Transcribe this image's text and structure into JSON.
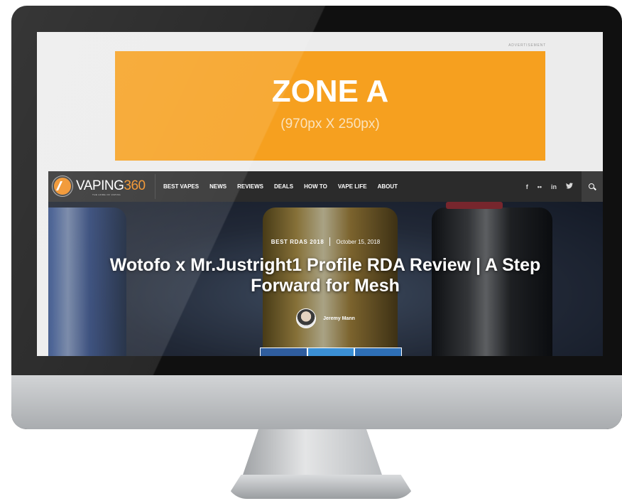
{
  "ad": {
    "label": "ADVERTISEMENT",
    "title": "ZONE A",
    "subtitle": "(970px X 250px)",
    "color": "#f6a01f"
  },
  "site": {
    "logo_text": "VAPING",
    "logo_number": "360",
    "tagline": "THE HOME OF VAPING",
    "accent": "#f08c1f"
  },
  "nav": {
    "items": [
      "BEST VAPES",
      "NEWS",
      "REVIEWS",
      "DEALS",
      "HOW TO",
      "VAPE LIFE",
      "ABOUT"
    ]
  },
  "social": {
    "facebook": "f",
    "flickr": "••",
    "linkedin": "in",
    "twitter": "🐦"
  },
  "article": {
    "category": "BEST RDAS 2018",
    "date": "October 15, 2018",
    "title": "Wotofo x Mr.Justright1 Profile RDA Review | A Step Forward for Mesh",
    "author": "Jeremy Mann"
  }
}
